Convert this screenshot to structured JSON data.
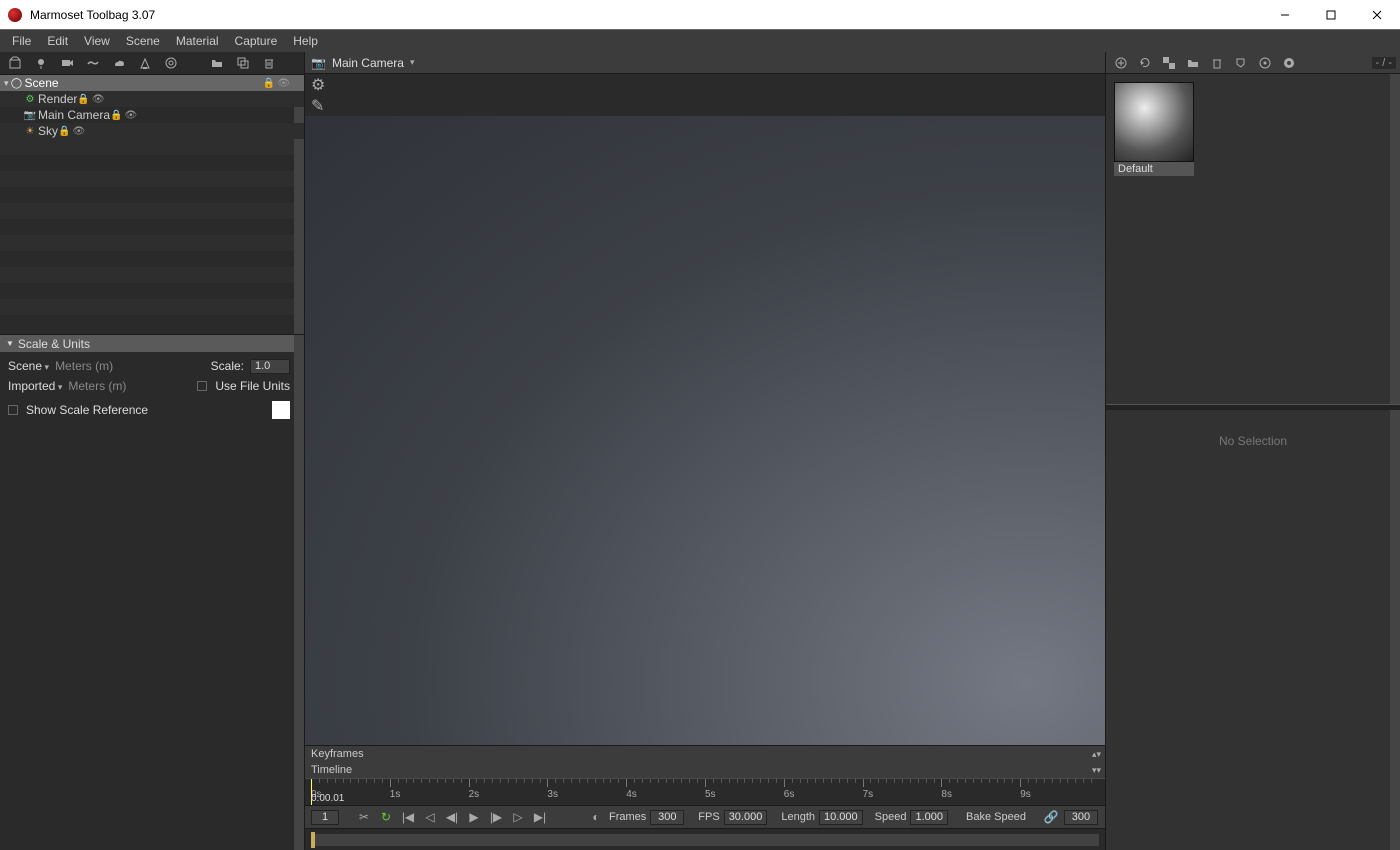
{
  "window": {
    "title": "Marmoset Toolbag 3.07"
  },
  "menu": [
    "File",
    "Edit",
    "View",
    "Scene",
    "Material",
    "Capture",
    "Help"
  ],
  "scene_tree": {
    "root": "Scene",
    "children": [
      {
        "label": "Render",
        "icon": "gear"
      },
      {
        "label": "Main Camera",
        "icon": "camera"
      },
      {
        "label": "Sky",
        "icon": "sky"
      }
    ]
  },
  "scale_panel": {
    "title": "Scale & Units",
    "scene_label": "Scene",
    "scene_unit": "Meters (m)",
    "scale_label": "Scale:",
    "scale_value": "1.0",
    "imported_label": "Imported",
    "imported_unit": "Meters (m)",
    "use_file_units": "Use File Units",
    "show_scale_ref": "Show Scale Reference"
  },
  "viewport": {
    "camera_label": "Main Camera"
  },
  "timeline": {
    "keyframes_label": "Keyframes",
    "timeline_label": "Timeline",
    "timecode": "0:00.01",
    "seconds": [
      "0s",
      "1s",
      "2s",
      "3s",
      "4s",
      "5s",
      "6s",
      "7s",
      "8s",
      "9s"
    ],
    "frame_number": "1",
    "frames_label": "Frames",
    "frames_value": "300",
    "fps_label": "FPS",
    "fps_value": "30.000",
    "length_label": "Length",
    "length_value": "10.000",
    "speed_label": "Speed",
    "speed_value": "1.000",
    "bake_speed_label": "Bake Speed",
    "bake_frames": "300"
  },
  "materials": {
    "default_name": "Default",
    "count_label": "- / -",
    "no_selection": "No Selection"
  }
}
